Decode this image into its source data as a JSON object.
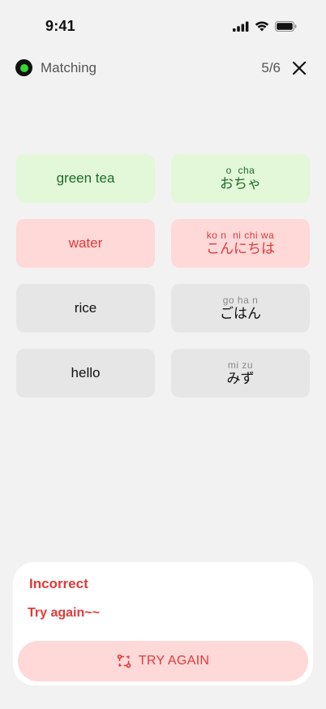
{
  "status_bar": {
    "time": "9:41",
    "icons": [
      "cellular-signal-icon",
      "wifi-icon",
      "battery-icon"
    ]
  },
  "header": {
    "title": "Matching",
    "progress": "5/6",
    "close_icon": "close-icon",
    "indicator_color": "#38d430"
  },
  "cards": {
    "left": [
      {
        "text": "green tea",
        "state": "correct"
      },
      {
        "text": "water",
        "state": "incorrect"
      },
      {
        "text": "rice",
        "state": "neutral"
      },
      {
        "text": "hello",
        "state": "neutral"
      }
    ],
    "right": [
      {
        "reading": "o  cha",
        "kana": "おちゃ",
        "state": "correct"
      },
      {
        "reading": "ko n  ni chi wa",
        "kana": "こんにちは",
        "state": "incorrect"
      },
      {
        "reading": "go ha n",
        "kana": "ごはん",
        "state": "neutral"
      },
      {
        "reading": "mi zu",
        "kana": "みず",
        "state": "neutral"
      }
    ]
  },
  "feedback": {
    "title": "Incorrect",
    "message": "Try again~~",
    "button_label": "TRY AGAIN",
    "button_icon": "retry-icon"
  },
  "colors": {
    "correct_bg": "#e3f7d9",
    "correct_text": "#1d6b2a",
    "incorrect_bg": "#ffd8d8",
    "incorrect_text": "#e03a3a",
    "neutral_bg": "#e6e6e6"
  }
}
